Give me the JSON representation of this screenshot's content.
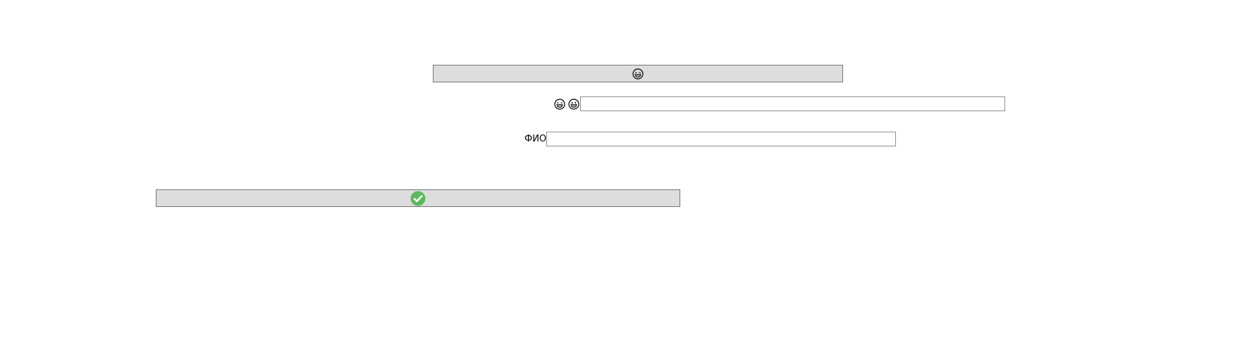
{
  "form": {
    "top_button": {
      "icon": "grinning-face-with-smiling-eyes-icon"
    },
    "emoji_row": {
      "icons": [
        "grinning-face-with-smiling-eyes-icon",
        "grinning-face-icon"
      ],
      "input_value": "",
      "input_placeholder": ""
    },
    "fio_row": {
      "label": "ФИО",
      "input_value": "",
      "input_placeholder": ""
    },
    "confirm_button": {
      "icon": "check-circle-icon",
      "icon_color": "#5cb85c"
    }
  },
  "colors": {
    "button_bg": "#dddddd",
    "button_border": "#767676",
    "input_border": "#8f8f8f",
    "background": "#ffffff"
  }
}
